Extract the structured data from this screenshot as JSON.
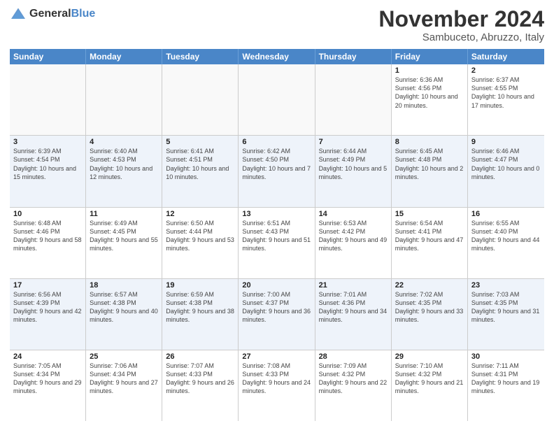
{
  "logo": {
    "line1": "General",
    "line2": "Blue"
  },
  "title": "November 2024",
  "location": "Sambuceto, Abruzzo, Italy",
  "days_of_week": [
    "Sunday",
    "Monday",
    "Tuesday",
    "Wednesday",
    "Thursday",
    "Friday",
    "Saturday"
  ],
  "weeks": [
    [
      {
        "day": "",
        "info": "",
        "empty": true
      },
      {
        "day": "",
        "info": "",
        "empty": true
      },
      {
        "day": "",
        "info": "",
        "empty": true
      },
      {
        "day": "",
        "info": "",
        "empty": true
      },
      {
        "day": "",
        "info": "",
        "empty": true
      },
      {
        "day": "1",
        "info": "Sunrise: 6:36 AM\nSunset: 4:56 PM\nDaylight: 10 hours and 20 minutes."
      },
      {
        "day": "2",
        "info": "Sunrise: 6:37 AM\nSunset: 4:55 PM\nDaylight: 10 hours and 17 minutes."
      }
    ],
    [
      {
        "day": "3",
        "info": "Sunrise: 6:39 AM\nSunset: 4:54 PM\nDaylight: 10 hours and 15 minutes."
      },
      {
        "day": "4",
        "info": "Sunrise: 6:40 AM\nSunset: 4:53 PM\nDaylight: 10 hours and 12 minutes."
      },
      {
        "day": "5",
        "info": "Sunrise: 6:41 AM\nSunset: 4:51 PM\nDaylight: 10 hours and 10 minutes."
      },
      {
        "day": "6",
        "info": "Sunrise: 6:42 AM\nSunset: 4:50 PM\nDaylight: 10 hours and 7 minutes."
      },
      {
        "day": "7",
        "info": "Sunrise: 6:44 AM\nSunset: 4:49 PM\nDaylight: 10 hours and 5 minutes."
      },
      {
        "day": "8",
        "info": "Sunrise: 6:45 AM\nSunset: 4:48 PM\nDaylight: 10 hours and 2 minutes."
      },
      {
        "day": "9",
        "info": "Sunrise: 6:46 AM\nSunset: 4:47 PM\nDaylight: 10 hours and 0 minutes."
      }
    ],
    [
      {
        "day": "10",
        "info": "Sunrise: 6:48 AM\nSunset: 4:46 PM\nDaylight: 9 hours and 58 minutes."
      },
      {
        "day": "11",
        "info": "Sunrise: 6:49 AM\nSunset: 4:45 PM\nDaylight: 9 hours and 55 minutes."
      },
      {
        "day": "12",
        "info": "Sunrise: 6:50 AM\nSunset: 4:44 PM\nDaylight: 9 hours and 53 minutes."
      },
      {
        "day": "13",
        "info": "Sunrise: 6:51 AM\nSunset: 4:43 PM\nDaylight: 9 hours and 51 minutes."
      },
      {
        "day": "14",
        "info": "Sunrise: 6:53 AM\nSunset: 4:42 PM\nDaylight: 9 hours and 49 minutes."
      },
      {
        "day": "15",
        "info": "Sunrise: 6:54 AM\nSunset: 4:41 PM\nDaylight: 9 hours and 47 minutes."
      },
      {
        "day": "16",
        "info": "Sunrise: 6:55 AM\nSunset: 4:40 PM\nDaylight: 9 hours and 44 minutes."
      }
    ],
    [
      {
        "day": "17",
        "info": "Sunrise: 6:56 AM\nSunset: 4:39 PM\nDaylight: 9 hours and 42 minutes."
      },
      {
        "day": "18",
        "info": "Sunrise: 6:57 AM\nSunset: 4:38 PM\nDaylight: 9 hours and 40 minutes."
      },
      {
        "day": "19",
        "info": "Sunrise: 6:59 AM\nSunset: 4:38 PM\nDaylight: 9 hours and 38 minutes."
      },
      {
        "day": "20",
        "info": "Sunrise: 7:00 AM\nSunset: 4:37 PM\nDaylight: 9 hours and 36 minutes."
      },
      {
        "day": "21",
        "info": "Sunrise: 7:01 AM\nSunset: 4:36 PM\nDaylight: 9 hours and 34 minutes."
      },
      {
        "day": "22",
        "info": "Sunrise: 7:02 AM\nSunset: 4:35 PM\nDaylight: 9 hours and 33 minutes."
      },
      {
        "day": "23",
        "info": "Sunrise: 7:03 AM\nSunset: 4:35 PM\nDaylight: 9 hours and 31 minutes."
      }
    ],
    [
      {
        "day": "24",
        "info": "Sunrise: 7:05 AM\nSunset: 4:34 PM\nDaylight: 9 hours and 29 minutes."
      },
      {
        "day": "25",
        "info": "Sunrise: 7:06 AM\nSunset: 4:34 PM\nDaylight: 9 hours and 27 minutes."
      },
      {
        "day": "26",
        "info": "Sunrise: 7:07 AM\nSunset: 4:33 PM\nDaylight: 9 hours and 26 minutes."
      },
      {
        "day": "27",
        "info": "Sunrise: 7:08 AM\nSunset: 4:33 PM\nDaylight: 9 hours and 24 minutes."
      },
      {
        "day": "28",
        "info": "Sunrise: 7:09 AM\nSunset: 4:32 PM\nDaylight: 9 hours and 22 minutes."
      },
      {
        "day": "29",
        "info": "Sunrise: 7:10 AM\nSunset: 4:32 PM\nDaylight: 9 hours and 21 minutes."
      },
      {
        "day": "30",
        "info": "Sunrise: 7:11 AM\nSunset: 4:31 PM\nDaylight: 9 hours and 19 minutes."
      }
    ]
  ]
}
